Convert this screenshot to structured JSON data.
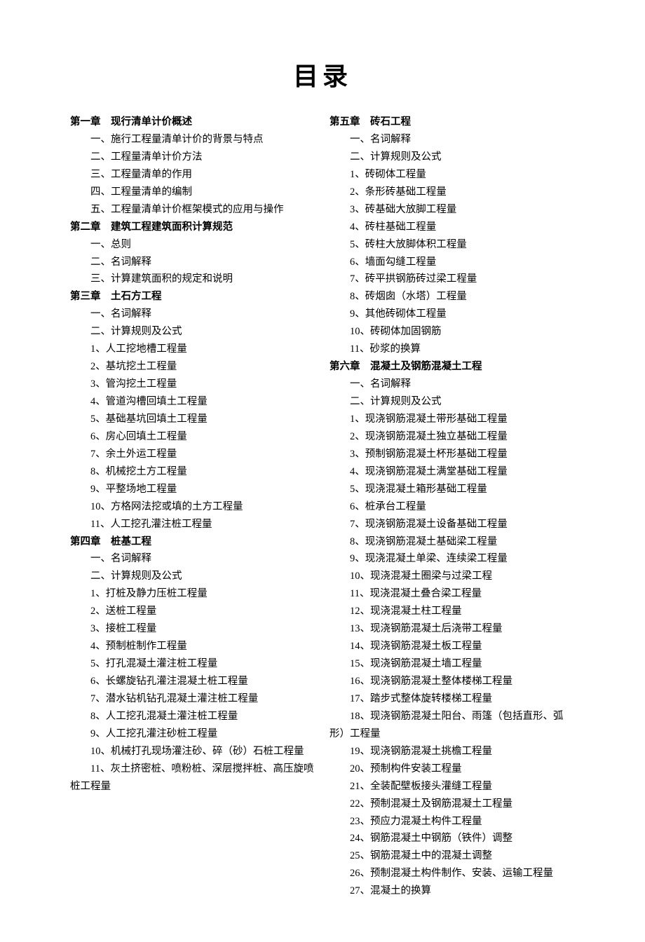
{
  "title": "目录",
  "left": [
    {
      "type": "chapter",
      "text": "第一章 现行清单计价概述"
    },
    {
      "type": "item",
      "text": "一、施行工程量清单计价的背景与特点"
    },
    {
      "type": "item",
      "text": "二、工程量清单计价方法"
    },
    {
      "type": "item",
      "text": "三、工程量清单的作用"
    },
    {
      "type": "item",
      "text": "四、工程量清单的编制"
    },
    {
      "type": "item",
      "text": "五、工程量清单计价框架模式的应用与操作"
    },
    {
      "type": "chapter",
      "text": "第二章 建筑工程建筑面积计算规范"
    },
    {
      "type": "item",
      "text": "一、总则"
    },
    {
      "type": "item",
      "text": "二、名词解释"
    },
    {
      "type": "item",
      "text": "三、计算建筑面积的规定和说明"
    },
    {
      "type": "chapter",
      "text": "第三章 土石方工程"
    },
    {
      "type": "item",
      "text": "一、名词解释"
    },
    {
      "type": "item",
      "text": "二、计算规则及公式"
    },
    {
      "type": "item",
      "text": "1、人工挖地槽工程量"
    },
    {
      "type": "item",
      "text": "2、基坑挖土工程量"
    },
    {
      "type": "item",
      "text": "3、管沟挖土工程量"
    },
    {
      "type": "item",
      "text": "4、管道沟槽回填土工程量"
    },
    {
      "type": "item",
      "text": "5、基础基坑回填土工程量"
    },
    {
      "type": "item",
      "text": "6、房心回填土工程量"
    },
    {
      "type": "item",
      "text": "7、余土外运工程量"
    },
    {
      "type": "item",
      "text": "8、机械挖土方工程量"
    },
    {
      "type": "item",
      "text": "9、平整场地工程量"
    },
    {
      "type": "item",
      "text": "10、方格网法挖或填的土方工程量"
    },
    {
      "type": "item",
      "text": "11、人工挖孔灌注桩工程量"
    },
    {
      "type": "chapter",
      "text": "第四章 桩基工程"
    },
    {
      "type": "item",
      "text": "一、名词解释"
    },
    {
      "type": "item",
      "text": "二、计算规则及公式"
    },
    {
      "type": "item",
      "text": "1、打桩及静力压桩工程量"
    },
    {
      "type": "item",
      "text": "2、送桩工程量"
    },
    {
      "type": "item",
      "text": "3、接桩工程量"
    },
    {
      "type": "item",
      "text": "4、预制桩制作工程量"
    },
    {
      "type": "item",
      "text": "5、打孔混凝土灌注桩工程量"
    },
    {
      "type": "item",
      "text": "6、长螺旋钻孔灌注混凝土桩工程量"
    },
    {
      "type": "item",
      "text": "7、潜水钻机钻孔混凝土灌注桩工程量"
    },
    {
      "type": "item",
      "text": "8、人工挖孔混凝土灌注桩工程量"
    },
    {
      "type": "item",
      "text": "9、人工挖孔灌注砂桩工程量"
    },
    {
      "type": "item",
      "text": "10、机械打孔现场灌注砂、碎（砂）石桩工程量"
    },
    {
      "type": "item",
      "text": "​  11、灰土挤密桩、喷粉桩、深层搅拌桩、高压旋喷桩工程量",
      "wrap": true
    }
  ],
  "right": [
    {
      "type": "chapter",
      "text": "第五章 砖石工程"
    },
    {
      "type": "item",
      "text": "一、名词解释"
    },
    {
      "type": "item",
      "text": "二、计算规则及公式"
    },
    {
      "type": "item",
      "text": "1、砖砌体工程量"
    },
    {
      "type": "item",
      "text": "2、条形砖基础工程量"
    },
    {
      "type": "item",
      "text": "3、砖基础大放脚工程量"
    },
    {
      "type": "item",
      "text": "4、砖柱基础工程量"
    },
    {
      "type": "item",
      "text": "5、砖柱大放脚体积工程量"
    },
    {
      "type": "item",
      "text": "6、墙面勾缝工程量"
    },
    {
      "type": "item",
      "text": "7、砖平拱钢筋砖过梁工程量"
    },
    {
      "type": "item",
      "text": "8、砖烟囱（水塔）工程量"
    },
    {
      "type": "item",
      "text": "9、其他砖砌体工程量"
    },
    {
      "type": "item",
      "text": "10、砖砌体加固钢筋"
    },
    {
      "type": "item",
      "text": "11、砂浆的换算"
    },
    {
      "type": "chapter",
      "text": "第六章 混凝土及钢筋混凝土工程"
    },
    {
      "type": "item",
      "text": "一、名词解释"
    },
    {
      "type": "item",
      "text": "二、计算规则及公式"
    },
    {
      "type": "item",
      "text": "1、现浇钢筋混凝土带形基础工程量"
    },
    {
      "type": "item",
      "text": "2、现浇钢筋混凝土独立基础工程量"
    },
    {
      "type": "item",
      "text": "3、预制钢筋混凝土杯形基础工程量"
    },
    {
      "type": "item",
      "text": "4、现浇钢筋混凝土满堂基础工程量"
    },
    {
      "type": "item",
      "text": "5、现浇混凝土箱形基础工程量"
    },
    {
      "type": "item",
      "text": "6、桩承台工程量"
    },
    {
      "type": "item",
      "text": "7、现浇钢筋混凝土设备基础工程量"
    },
    {
      "type": "item",
      "text": "8、现浇钢筋混凝土基础梁工程量"
    },
    {
      "type": "item",
      "text": "9、现浇混凝土单梁、连续梁工程量"
    },
    {
      "type": "item",
      "text": "10、现浇混凝土圈梁与过梁工程"
    },
    {
      "type": "item",
      "text": "11、现浇混凝土叠合梁工程量"
    },
    {
      "type": "item",
      "text": "12、现浇混凝土柱工程量"
    },
    {
      "type": "item",
      "text": "13、现浇钢筋混凝土后浇带工程量"
    },
    {
      "type": "item",
      "text": "14、现浇钢筋混凝土板工程量"
    },
    {
      "type": "item",
      "text": "15、现浇钢筋混凝土墙工程量"
    },
    {
      "type": "item",
      "text": "16、现浇钢筋混凝土整体楼梯工程量"
    },
    {
      "type": "item",
      "text": "17、踏步式整体旋转楼梯工程量"
    },
    {
      "type": "item",
      "text": "​  18、现浇钢筋混凝土阳台、雨篷（包括直形、弧形）工程量",
      "wrap": true
    },
    {
      "type": "item",
      "text": "19、现浇钢筋混凝土挑檐工程量"
    },
    {
      "type": "item",
      "text": "20、预制构件安装工程量"
    },
    {
      "type": "item",
      "text": "21、全装配壁板接头灌缝工程量"
    },
    {
      "type": "item",
      "text": "22、预制混凝土及钢筋混凝土工程量"
    },
    {
      "type": "item",
      "text": "23、预应力混凝土构件工程量"
    },
    {
      "type": "item",
      "text": "24、钢筋混凝土中钢筋（铁件）调整"
    },
    {
      "type": "item",
      "text": "25、钢筋混凝土中的混凝土调整"
    },
    {
      "type": "item",
      "text": "26、预制混凝土构件制作、安装、运输工程量"
    },
    {
      "type": "item",
      "text": "27、混凝土的换算"
    }
  ]
}
